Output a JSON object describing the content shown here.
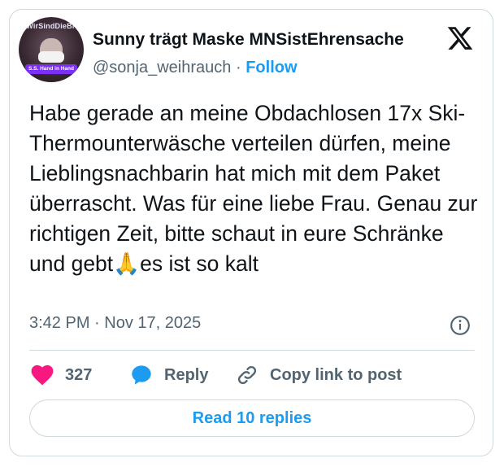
{
  "author": {
    "display_name": "Sunny trägt Maske MNSistEhrensache",
    "handle": "@sonja_weihrauch",
    "separator": "·",
    "follow_label": "Follow",
    "avatar_ring_text": "#WirSindDieBrandmauer",
    "avatar_band_text": "S.S. Hand in Hand"
  },
  "tweet": {
    "text_before_emoji": "Habe gerade an meine Obdachlosen 17x Ski-Thermounterwäsche verteilen dürfen, meine Lieblingsnachbarin hat mich mit dem Paket überrascht. Was für eine liebe Frau. Genau zur richtigen Zeit, bitte schaut in eure Schränke und gebt",
    "emoji": "🙏",
    "text_after_emoji": "es ist so kalt",
    "timestamp": "3:42 PM · Nov 17, 2025"
  },
  "actions": {
    "like_count": "327",
    "reply_label": "Reply",
    "copy_link_label": "Copy link to post"
  },
  "read_replies_label": "Read 10 replies",
  "colors": {
    "accent": "#1d9bf0",
    "like": "#f91880",
    "muted": "#536471",
    "border": "#cfd9de"
  },
  "icons": [
    "x-logo-icon",
    "info-icon",
    "heart-icon",
    "reply-bubble-icon",
    "link-icon",
    "pray-emoji-icon"
  ]
}
